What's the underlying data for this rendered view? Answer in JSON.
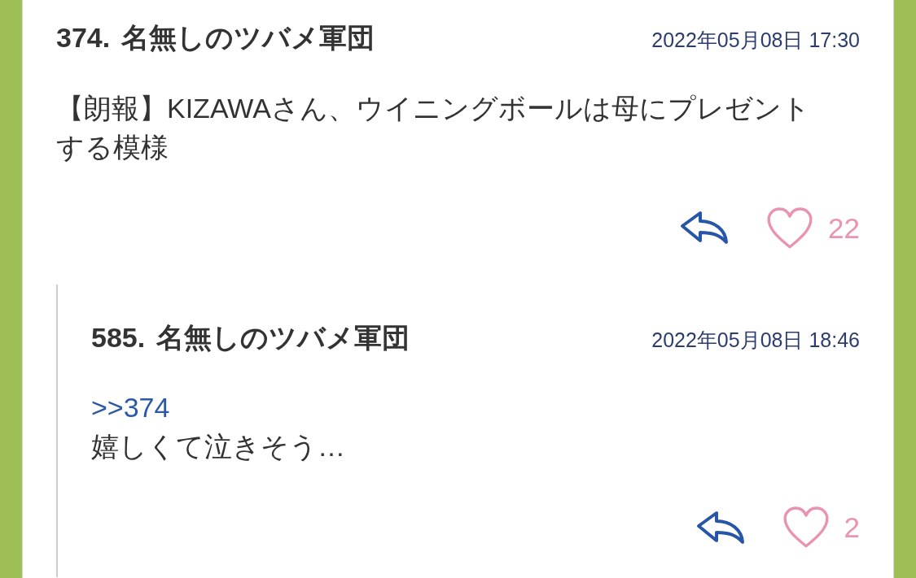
{
  "thread": [
    {
      "number": "374.",
      "author": "名無しのツバメ軍団",
      "date": "2022年05月08日 17:30",
      "body": [
        {
          "kind": "text",
          "text": "【朗報】KIZAWAさん、ウイニングボールは母にプレゼントする模様"
        }
      ],
      "likes": "22",
      "replies": [
        {
          "number": "585.",
          "author": "名無しのツバメ軍団",
          "date": "2022年05月08日 18:46",
          "body": [
            {
              "kind": "anchor",
              "text": ">>374"
            },
            {
              "kind": "text",
              "text": "嬉しくて泣きそう…"
            }
          ],
          "likes": "2"
        }
      ]
    }
  ]
}
